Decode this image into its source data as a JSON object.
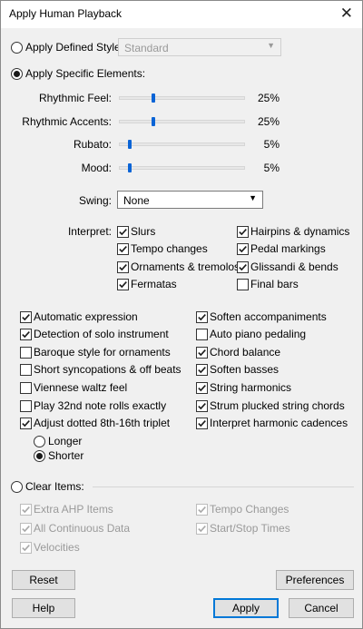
{
  "window": {
    "title": "Apply Human Playback",
    "close_glyph": "✕"
  },
  "defined_style": {
    "label": "Apply Defined Style:",
    "selected": false,
    "value": "Standard"
  },
  "specific": {
    "label": "Apply Specific Elements:",
    "selected": true,
    "sliders": [
      {
        "label": "Rhythmic Feel:",
        "value": 25,
        "display": "25%"
      },
      {
        "label": "Rhythmic Accents:",
        "value": 25,
        "display": "25%"
      },
      {
        "label": "Rubato:",
        "value": 5,
        "display": "5%"
      },
      {
        "label": "Mood:",
        "value": 5,
        "display": "5%"
      }
    ],
    "swing": {
      "label": "Swing:",
      "value": "None"
    },
    "interpret": {
      "label": "Interpret:",
      "left": [
        {
          "label": "Slurs",
          "checked": true
        },
        {
          "label": "Tempo changes",
          "checked": true
        },
        {
          "label": "Ornaments & tremolos",
          "checked": true
        },
        {
          "label": "Fermatas",
          "checked": true
        }
      ],
      "right": [
        {
          "label": "Hairpins & dynamics",
          "checked": true
        },
        {
          "label": "Pedal markings",
          "checked": true
        },
        {
          "label": "Glissandi & bends",
          "checked": true
        },
        {
          "label": "Final bars",
          "checked": false
        }
      ]
    },
    "options_left": [
      {
        "label": "Automatic expression",
        "checked": true
      },
      {
        "label": "Detection of solo instrument",
        "checked": true
      },
      {
        "label": "Baroque style for ornaments",
        "checked": false
      },
      {
        "label": "Short syncopations & off beats",
        "checked": false
      },
      {
        "label": "Viennese waltz feel",
        "checked": false
      },
      {
        "label": "Play 32nd note rolls exactly",
        "checked": false
      },
      {
        "label": "Adjust dotted 8th-16th triplet",
        "checked": true
      }
    ],
    "options_right": [
      {
        "label": "Soften accompaniments",
        "checked": true
      },
      {
        "label": "Auto piano pedaling",
        "checked": false
      },
      {
        "label": "Chord balance",
        "checked": true
      },
      {
        "label": "Soften basses",
        "checked": true
      },
      {
        "label": "String harmonics",
        "checked": true
      },
      {
        "label": "Strum plucked string chords",
        "checked": true
      },
      {
        "label": "Interpret harmonic cadences",
        "checked": true
      }
    ],
    "triplet_mode": [
      {
        "label": "Longer",
        "selected": false
      },
      {
        "label": "Shorter",
        "selected": true
      }
    ]
  },
  "clear": {
    "label": "Clear Items:",
    "selected": false,
    "left": [
      {
        "label": "Extra AHP Items",
        "checked": true
      },
      {
        "label": "All Continuous Data",
        "checked": true
      },
      {
        "label": "Velocities",
        "checked": true
      }
    ],
    "right": [
      {
        "label": "Tempo Changes",
        "checked": true
      },
      {
        "label": "Start/Stop Times",
        "checked": true
      }
    ]
  },
  "buttons": {
    "reset": "Reset",
    "preferences": "Preferences",
    "help": "Help",
    "apply": "Apply",
    "cancel": "Cancel"
  }
}
